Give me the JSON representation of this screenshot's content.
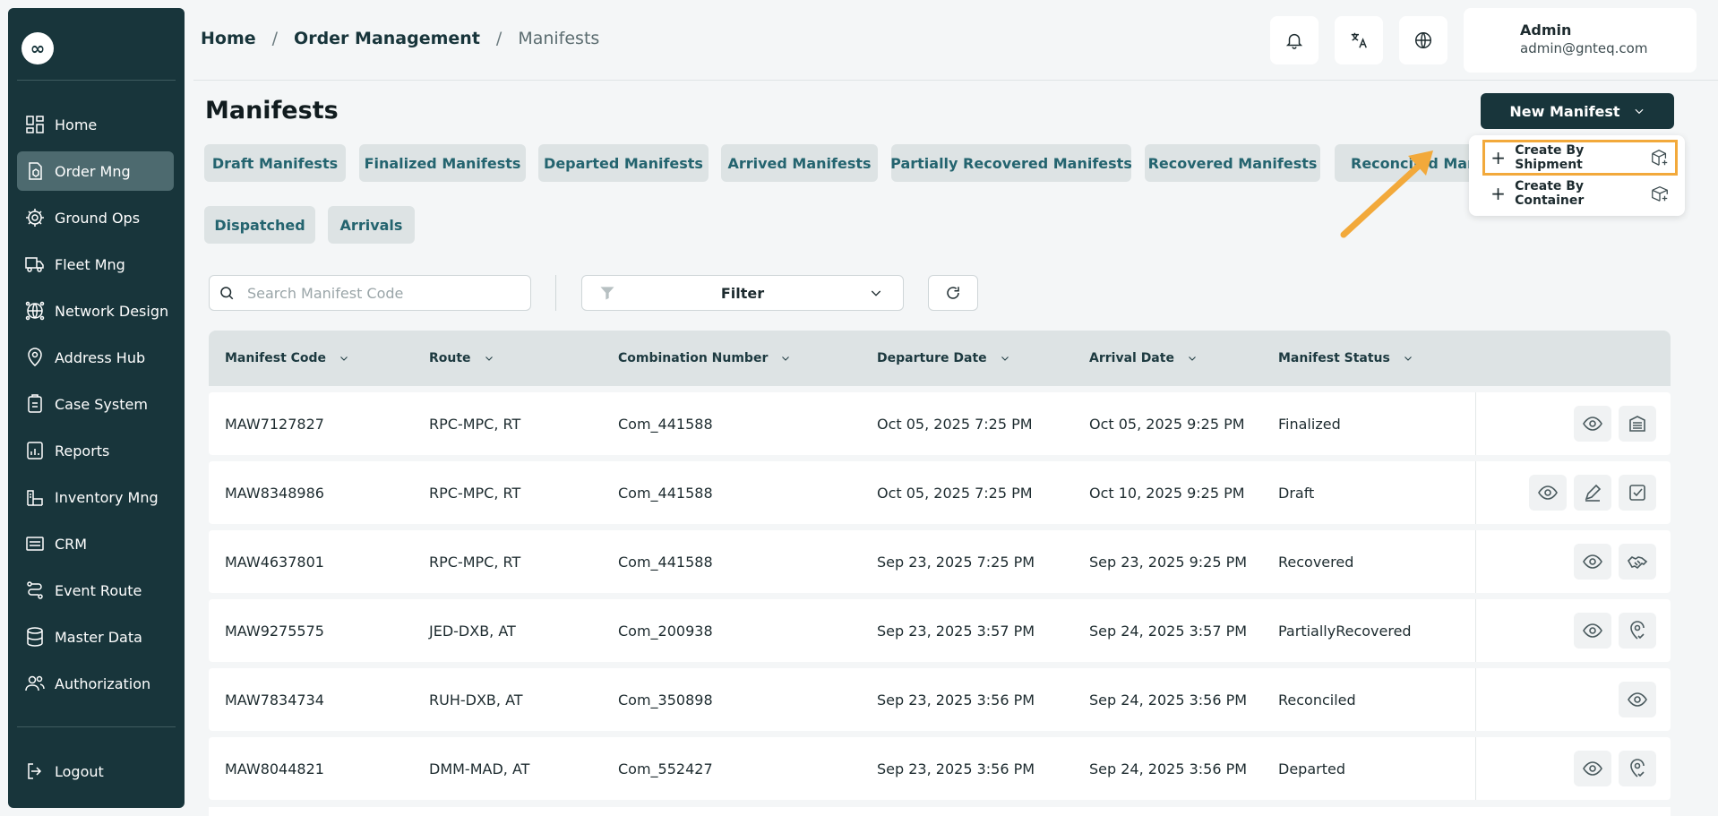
{
  "sidebar": {
    "logo": "∞",
    "items": [
      {
        "label": "Home",
        "icon": "grid-icon"
      },
      {
        "label": "Order Mng",
        "icon": "order-icon",
        "active": true
      },
      {
        "label": "Ground Ops",
        "icon": "gear-icon"
      },
      {
        "label": "Fleet Mng",
        "icon": "truck-icon"
      },
      {
        "label": "Network Design",
        "icon": "network-icon"
      },
      {
        "label": "Address Hub",
        "icon": "location-icon"
      },
      {
        "label": "Case System",
        "icon": "case-icon"
      },
      {
        "label": "Reports",
        "icon": "reports-icon"
      },
      {
        "label": "Inventory Mng",
        "icon": "inventory-icon"
      },
      {
        "label": "CRM",
        "icon": "crm-icon"
      },
      {
        "label": "Event Route",
        "icon": "route-icon"
      },
      {
        "label": "Master Data",
        "icon": "database-icon"
      },
      {
        "label": "Authorization",
        "icon": "users-icon"
      }
    ],
    "logout": "Logout"
  },
  "header": {
    "breadcrumb": [
      "Home",
      "Order Management",
      "Manifests"
    ],
    "separator": "/",
    "user": {
      "name": "Admin",
      "email": "admin@gnteq.com"
    }
  },
  "page": {
    "title": "Manifests",
    "new_button": "New Manifest",
    "menu": [
      "Create By Shipment",
      "Create By Container"
    ],
    "tabs": [
      "Draft Manifests",
      "Finalized Manifests",
      "Departed Manifests",
      "Arrived Manifests",
      "Partially Recovered Manifests",
      "Recovered Manifests",
      "Reconciled Manifests",
      "Dispatched",
      "Arrivals"
    ]
  },
  "search": {
    "placeholder": "Search Manifest Code"
  },
  "filter": {
    "label": "Filter"
  },
  "table": {
    "columns": [
      "Manifest Code",
      "Route",
      "Combination Number",
      "Departure Date",
      "Arrival Date",
      "Manifest Status"
    ],
    "rows": [
      {
        "code": "MAW7127827",
        "route": "RPC-MPC, RT",
        "combo": "Com_441588",
        "departure": "Oct 05, 2025 7:25 PM",
        "arrival": "Oct 05, 2025 9:25 PM",
        "status": "Finalized"
      },
      {
        "code": "MAW8348986",
        "route": "RPC-MPC, RT",
        "combo": "Com_441588",
        "departure": "Oct 05, 2025 7:25 PM",
        "arrival": "Oct 10, 2025 9:25 PM",
        "status": "Draft"
      },
      {
        "code": "MAW4637801",
        "route": "RPC-MPC, RT",
        "combo": "Com_441588",
        "departure": "Sep 23, 2025 7:25 PM",
        "arrival": "Sep 23, 2025 9:25 PM",
        "status": "Recovered"
      },
      {
        "code": "MAW9275575",
        "route": "JED-DXB, AT",
        "combo": "Com_200938",
        "departure": "Sep 23, 2025 3:57 PM",
        "arrival": "Sep 24, 2025 3:57 PM",
        "status": "PartiallyRecovered"
      },
      {
        "code": "MAW7834734",
        "route": "RUH-DXB, AT",
        "combo": "Com_350898",
        "departure": "Sep 23, 2025 3:56 PM",
        "arrival": "Sep 24, 2025 3:56 PM",
        "status": "Reconciled"
      },
      {
        "code": "MAW8044821",
        "route": "DMM-MAD, AT",
        "combo": "Com_552427",
        "departure": "Sep 23, 2025 3:56 PM",
        "arrival": "Sep 24, 2025 3:56 PM",
        "status": "Departed"
      }
    ]
  },
  "colors": {
    "sidebar": "#18353b",
    "accent": "#f2a93b",
    "tab_text": "#24646f"
  }
}
